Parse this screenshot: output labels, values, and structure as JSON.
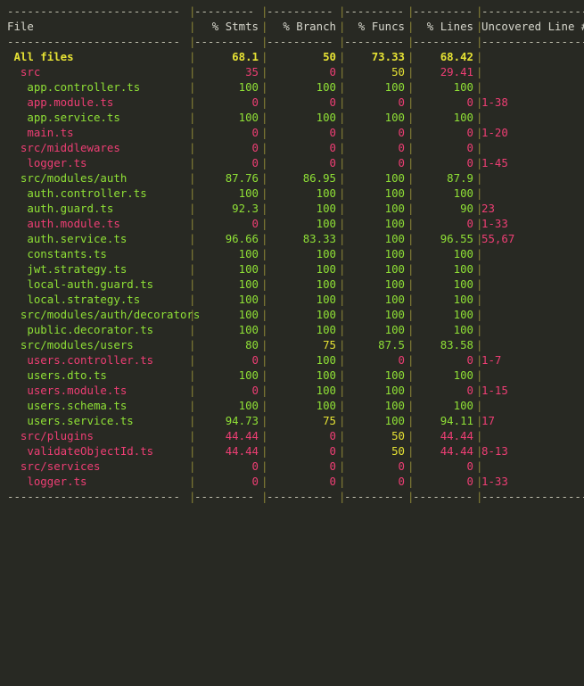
{
  "terminal": {
    "background": "#282923",
    "colors": {
      "green": "#8fe036",
      "yellow": "#e6e234",
      "red": "#ee3e74",
      "header": "#d6d6cc",
      "separator": "#8a8436",
      "dashes": "#c0bfae"
    }
  },
  "table": {
    "headers": {
      "file": "File",
      "stmts": "% Stmts",
      "branch": "% Branch",
      "funcs": "% Funcs",
      "lines": "% Lines",
      "uncovered": "Uncovered Line #s"
    },
    "separators": {
      "file": "--------------------------",
      "stmts": "---------",
      "branch": "----------",
      "funcs": "---------",
      "lines": "---------",
      "uncovered": "-------------------"
    },
    "separator_pipe": "|",
    "rows": [
      {
        "name": " All files",
        "name_color": "yellow",
        "bold": true,
        "stmts": "68.1",
        "stmts_color": "yellow",
        "branch": "50",
        "branch_color": "yellow",
        "funcs": "73.33",
        "funcs_color": "yellow",
        "lines": "68.42",
        "lines_color": "yellow",
        "uncovered": "",
        "uncovered_color": "red"
      },
      {
        "name": "  src",
        "name_color": "red",
        "bold": false,
        "stmts": "35",
        "stmts_color": "red",
        "branch": "0",
        "branch_color": "red",
        "funcs": "50",
        "funcs_color": "yellow",
        "lines": "29.41",
        "lines_color": "red",
        "uncovered": "",
        "uncovered_color": "red"
      },
      {
        "name": "   app.controller.ts",
        "name_color": "green",
        "bold": false,
        "stmts": "100",
        "stmts_color": "green",
        "branch": "100",
        "branch_color": "green",
        "funcs": "100",
        "funcs_color": "green",
        "lines": "100",
        "lines_color": "green",
        "uncovered": "",
        "uncovered_color": "red"
      },
      {
        "name": "   app.module.ts",
        "name_color": "red",
        "bold": false,
        "stmts": "0",
        "stmts_color": "red",
        "branch": "0",
        "branch_color": "red",
        "funcs": "0",
        "funcs_color": "red",
        "lines": "0",
        "lines_color": "red",
        "uncovered": "1-38",
        "uncovered_color": "red"
      },
      {
        "name": "   app.service.ts",
        "name_color": "green",
        "bold": false,
        "stmts": "100",
        "stmts_color": "green",
        "branch": "100",
        "branch_color": "green",
        "funcs": "100",
        "funcs_color": "green",
        "lines": "100",
        "lines_color": "green",
        "uncovered": "",
        "uncovered_color": "red"
      },
      {
        "name": "   main.ts",
        "name_color": "red",
        "bold": false,
        "stmts": "0",
        "stmts_color": "red",
        "branch": "0",
        "branch_color": "red",
        "funcs": "0",
        "funcs_color": "red",
        "lines": "0",
        "lines_color": "red",
        "uncovered": "1-20",
        "uncovered_color": "red"
      },
      {
        "name": "  src/middlewares",
        "name_color": "red",
        "bold": false,
        "stmts": "0",
        "stmts_color": "red",
        "branch": "0",
        "branch_color": "red",
        "funcs": "0",
        "funcs_color": "red",
        "lines": "0",
        "lines_color": "red",
        "uncovered": "",
        "uncovered_color": "red"
      },
      {
        "name": "   logger.ts",
        "name_color": "red",
        "bold": false,
        "stmts": "0",
        "stmts_color": "red",
        "branch": "0",
        "branch_color": "red",
        "funcs": "0",
        "funcs_color": "red",
        "lines": "0",
        "lines_color": "red",
        "uncovered": "1-45",
        "uncovered_color": "red"
      },
      {
        "name": "  src/modules/auth",
        "name_color": "green",
        "bold": false,
        "stmts": "87.76",
        "stmts_color": "green",
        "branch": "86.95",
        "branch_color": "green",
        "funcs": "100",
        "funcs_color": "green",
        "lines": "87.9",
        "lines_color": "green",
        "uncovered": "",
        "uncovered_color": "red"
      },
      {
        "name": "   auth.controller.ts",
        "name_color": "green",
        "bold": false,
        "stmts": "100",
        "stmts_color": "green",
        "branch": "100",
        "branch_color": "green",
        "funcs": "100",
        "funcs_color": "green",
        "lines": "100",
        "lines_color": "green",
        "uncovered": "",
        "uncovered_color": "red"
      },
      {
        "name": "   auth.guard.ts",
        "name_color": "green",
        "bold": false,
        "stmts": "92.3",
        "stmts_color": "green",
        "branch": "100",
        "branch_color": "green",
        "funcs": "100",
        "funcs_color": "green",
        "lines": "90",
        "lines_color": "green",
        "uncovered": "23",
        "uncovered_color": "red"
      },
      {
        "name": "   auth.module.ts",
        "name_color": "red",
        "bold": false,
        "stmts": "0",
        "stmts_color": "red",
        "branch": "100",
        "branch_color": "green",
        "funcs": "100",
        "funcs_color": "green",
        "lines": "0",
        "lines_color": "red",
        "uncovered": "1-33",
        "uncovered_color": "red"
      },
      {
        "name": "   auth.service.ts",
        "name_color": "green",
        "bold": false,
        "stmts": "96.66",
        "stmts_color": "green",
        "branch": "83.33",
        "branch_color": "green",
        "funcs": "100",
        "funcs_color": "green",
        "lines": "96.55",
        "lines_color": "green",
        "uncovered": "55,67",
        "uncovered_color": "red"
      },
      {
        "name": "   constants.ts",
        "name_color": "green",
        "bold": false,
        "stmts": "100",
        "stmts_color": "green",
        "branch": "100",
        "branch_color": "green",
        "funcs": "100",
        "funcs_color": "green",
        "lines": "100",
        "lines_color": "green",
        "uncovered": "",
        "uncovered_color": "red"
      },
      {
        "name": "   jwt.strategy.ts",
        "name_color": "green",
        "bold": false,
        "stmts": "100",
        "stmts_color": "green",
        "branch": "100",
        "branch_color": "green",
        "funcs": "100",
        "funcs_color": "green",
        "lines": "100",
        "lines_color": "green",
        "uncovered": "",
        "uncovered_color": "red"
      },
      {
        "name": "   local-auth.guard.ts",
        "name_color": "green",
        "bold": false,
        "stmts": "100",
        "stmts_color": "green",
        "branch": "100",
        "branch_color": "green",
        "funcs": "100",
        "funcs_color": "green",
        "lines": "100",
        "lines_color": "green",
        "uncovered": "",
        "uncovered_color": "red"
      },
      {
        "name": "   local.strategy.ts",
        "name_color": "green",
        "bold": false,
        "stmts": "100",
        "stmts_color": "green",
        "branch": "100",
        "branch_color": "green",
        "funcs": "100",
        "funcs_color": "green",
        "lines": "100",
        "lines_color": "green",
        "uncovered": "",
        "uncovered_color": "red"
      },
      {
        "name": "  src/modules/auth/decorators",
        "name_color": "green",
        "bold": false,
        "stmts": "100",
        "stmts_color": "green",
        "branch": "100",
        "branch_color": "green",
        "funcs": "100",
        "funcs_color": "green",
        "lines": "100",
        "lines_color": "green",
        "uncovered": "",
        "uncovered_color": "red"
      },
      {
        "name": "   public.decorator.ts",
        "name_color": "green",
        "bold": false,
        "stmts": "100",
        "stmts_color": "green",
        "branch": "100",
        "branch_color": "green",
        "funcs": "100",
        "funcs_color": "green",
        "lines": "100",
        "lines_color": "green",
        "uncovered": "",
        "uncovered_color": "red"
      },
      {
        "name": "  src/modules/users",
        "name_color": "green",
        "bold": false,
        "stmts": "80",
        "stmts_color": "green",
        "branch": "75",
        "branch_color": "yellow",
        "funcs": "87.5",
        "funcs_color": "green",
        "lines": "83.58",
        "lines_color": "green",
        "uncovered": "",
        "uncovered_color": "red"
      },
      {
        "name": "   users.controller.ts",
        "name_color": "red",
        "bold": false,
        "stmts": "0",
        "stmts_color": "red",
        "branch": "100",
        "branch_color": "green",
        "funcs": "0",
        "funcs_color": "red",
        "lines": "0",
        "lines_color": "red",
        "uncovered": "1-7",
        "uncovered_color": "red"
      },
      {
        "name": "   users.dto.ts",
        "name_color": "green",
        "bold": false,
        "stmts": "100",
        "stmts_color": "green",
        "branch": "100",
        "branch_color": "green",
        "funcs": "100",
        "funcs_color": "green",
        "lines": "100",
        "lines_color": "green",
        "uncovered": "",
        "uncovered_color": "red"
      },
      {
        "name": "   users.module.ts",
        "name_color": "red",
        "bold": false,
        "stmts": "0",
        "stmts_color": "red",
        "branch": "100",
        "branch_color": "green",
        "funcs": "100",
        "funcs_color": "green",
        "lines": "0",
        "lines_color": "red",
        "uncovered": "1-15",
        "uncovered_color": "red"
      },
      {
        "name": "   users.schema.ts",
        "name_color": "green",
        "bold": false,
        "stmts": "100",
        "stmts_color": "green",
        "branch": "100",
        "branch_color": "green",
        "funcs": "100",
        "funcs_color": "green",
        "lines": "100",
        "lines_color": "green",
        "uncovered": "",
        "uncovered_color": "red"
      },
      {
        "name": "   users.service.ts",
        "name_color": "green",
        "bold": false,
        "stmts": "94.73",
        "stmts_color": "green",
        "branch": "75",
        "branch_color": "yellow",
        "funcs": "100",
        "funcs_color": "green",
        "lines": "94.11",
        "lines_color": "green",
        "uncovered": "17",
        "uncovered_color": "red"
      },
      {
        "name": "  src/plugins",
        "name_color": "red",
        "bold": false,
        "stmts": "44.44",
        "stmts_color": "red",
        "branch": "0",
        "branch_color": "red",
        "funcs": "50",
        "funcs_color": "yellow",
        "lines": "44.44",
        "lines_color": "red",
        "uncovered": "",
        "uncovered_color": "red"
      },
      {
        "name": "   validateObjectId.ts",
        "name_color": "red",
        "bold": false,
        "stmts": "44.44",
        "stmts_color": "red",
        "branch": "0",
        "branch_color": "red",
        "funcs": "50",
        "funcs_color": "yellow",
        "lines": "44.44",
        "lines_color": "red",
        "uncovered": "8-13",
        "uncovered_color": "red"
      },
      {
        "name": "  src/services",
        "name_color": "red",
        "bold": false,
        "stmts": "0",
        "stmts_color": "red",
        "branch": "0",
        "branch_color": "red",
        "funcs": "0",
        "funcs_color": "red",
        "lines": "0",
        "lines_color": "red",
        "uncovered": "",
        "uncovered_color": "red"
      },
      {
        "name": "   logger.ts",
        "name_color": "red",
        "bold": false,
        "stmts": "0",
        "stmts_color": "red",
        "branch": "0",
        "branch_color": "red",
        "funcs": "0",
        "funcs_color": "red",
        "lines": "0",
        "lines_color": "red",
        "uncovered": "1-33",
        "uncovered_color": "red"
      }
    ]
  }
}
